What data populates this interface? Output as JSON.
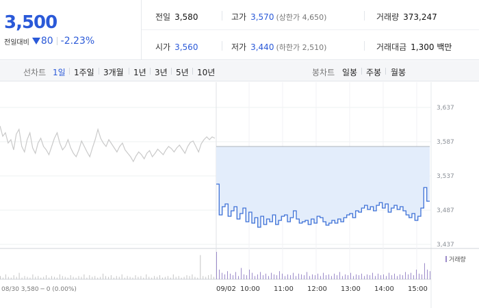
{
  "quote": {
    "price": "3,500",
    "change_label": "전일대비",
    "change_amount": "80",
    "change_rate": "-2.23%",
    "direction": "down",
    "stats": {
      "prev_close": {
        "label": "전일",
        "value": "3,580"
      },
      "high": {
        "label": "고가",
        "value": "3,570",
        "sub": "(상한가 4,650)"
      },
      "volume": {
        "label": "거래량",
        "value": "373,247"
      },
      "open": {
        "label": "시가",
        "value": "3,560"
      },
      "low": {
        "label": "저가",
        "value": "3,440",
        "sub": "(하한가 2,510)"
      },
      "trade_value": {
        "label": "거래대금",
        "value": "1,300 백만"
      }
    }
  },
  "tabs": {
    "line_label": "선차트",
    "line_periods": [
      "1일",
      "1주일",
      "3개월",
      "1년",
      "3년",
      "5년",
      "10년"
    ],
    "active_period": "1일",
    "candle_label": "봉차트",
    "candle_periods": [
      "일봉",
      "주봉",
      "월봉"
    ]
  },
  "colors": {
    "accent": "#2a59d8",
    "price_line": "#3b6fd6",
    "area_fill": "#e3edfb",
    "prev_day_line": "#c9c9c9",
    "volume_bar": "#9b8ac9"
  },
  "chart_data": {
    "type": "line",
    "y_ticks": [
      "3,637",
      "3,587",
      "3,537",
      "3,487",
      "3,437"
    ],
    "ylim": [
      3437,
      3637
    ],
    "prev_close": 3580,
    "x_ticks": [
      "09/02",
      "10:00",
      "11:00",
      "12:00",
      "13:00",
      "14:00",
      "15:00"
    ],
    "volume_legend": "거래량",
    "footer": "08/30  3,580 ─ 0 (0.00%)",
    "grid": true,
    "series": [
      {
        "name": "08/30",
        "values": [
          3610,
          3595,
          3600,
          3585,
          3590,
          3575,
          3598,
          3605,
          3580,
          3572,
          3590,
          3600,
          3578,
          3570,
          3585,
          3592,
          3580,
          3575,
          3568,
          3580,
          3592,
          3600,
          3585,
          3575,
          3580,
          3590,
          3578,
          3570,
          3565,
          3575,
          3588,
          3580,
          3572,
          3565,
          3578,
          3590,
          3605,
          3592,
          3585,
          3580,
          3590,
          3584,
          3578,
          3572,
          3580,
          3585,
          3575,
          3570,
          3565,
          3558,
          3566,
          3572,
          3568,
          3562,
          3570,
          3574,
          3565,
          3570,
          3576,
          3572,
          3568,
          3575,
          3580,
          3577,
          3572,
          3578,
          3582,
          3576,
          3570,
          3580,
          3586,
          3588,
          3580,
          3572,
          3584,
          3590,
          3594,
          3590,
          3594,
          3592
        ]
      },
      {
        "name": "09/02",
        "values": [
          3525,
          3480,
          3492,
          3496,
          3478,
          3486,
          3492,
          3474,
          3482,
          3490,
          3470,
          3484,
          3468,
          3476,
          3462,
          3478,
          3466,
          3474,
          3470,
          3480,
          3466,
          3472,
          3478,
          3480,
          3470,
          3476,
          3486,
          3474,
          3468,
          3470,
          3472,
          3466,
          3474,
          3468,
          3478,
          3476,
          3470,
          3465,
          3468,
          3472,
          3468,
          3474,
          3470,
          3476,
          3480,
          3482,
          3476,
          3486,
          3484,
          3490,
          3494,
          3488,
          3492,
          3486,
          3494,
          3498,
          3490,
          3496,
          3484,
          3490,
          3494,
          3488,
          3492,
          3486,
          3480,
          3476,
          3482,
          3472,
          3478,
          3490,
          3520,
          3500,
          3500
        ]
      }
    ],
    "volume": [
      4,
      2,
      6,
      3,
      2,
      5,
      3,
      8,
      2,
      4,
      3,
      2,
      6,
      3,
      4,
      2,
      3,
      5,
      2,
      4,
      3,
      2,
      6,
      4,
      3,
      2,
      5,
      3,
      2,
      4,
      3,
      6,
      2,
      5,
      3,
      4,
      2,
      3,
      7,
      4,
      3,
      5,
      2,
      4,
      3,
      6,
      2,
      4,
      3,
      2,
      5,
      3,
      4,
      2,
      6,
      3,
      2,
      4,
      3,
      5,
      2,
      3,
      4,
      2,
      6,
      3,
      4,
      2,
      3,
      5,
      4,
      6,
      3,
      2,
      30,
      4,
      3,
      5,
      6,
      3,
      34,
      12,
      8,
      6,
      10,
      7,
      5,
      9,
      4,
      14,
      6,
      5,
      12,
      8,
      4,
      6,
      9,
      5,
      7,
      4,
      8,
      6,
      5,
      10,
      7,
      4,
      6,
      5,
      8,
      4,
      7,
      6,
      5,
      9,
      4,
      6,
      5,
      7,
      4,
      8,
      5,
      6,
      4,
      7,
      5,
      9,
      4,
      6,
      5,
      8,
      4,
      6,
      5,
      7,
      4,
      6,
      5,
      8,
      4,
      7,
      5,
      6,
      4,
      8,
      5,
      7,
      4,
      6,
      5,
      9,
      6,
      8,
      5,
      12,
      7,
      6,
      20,
      12,
      10
    ]
  }
}
